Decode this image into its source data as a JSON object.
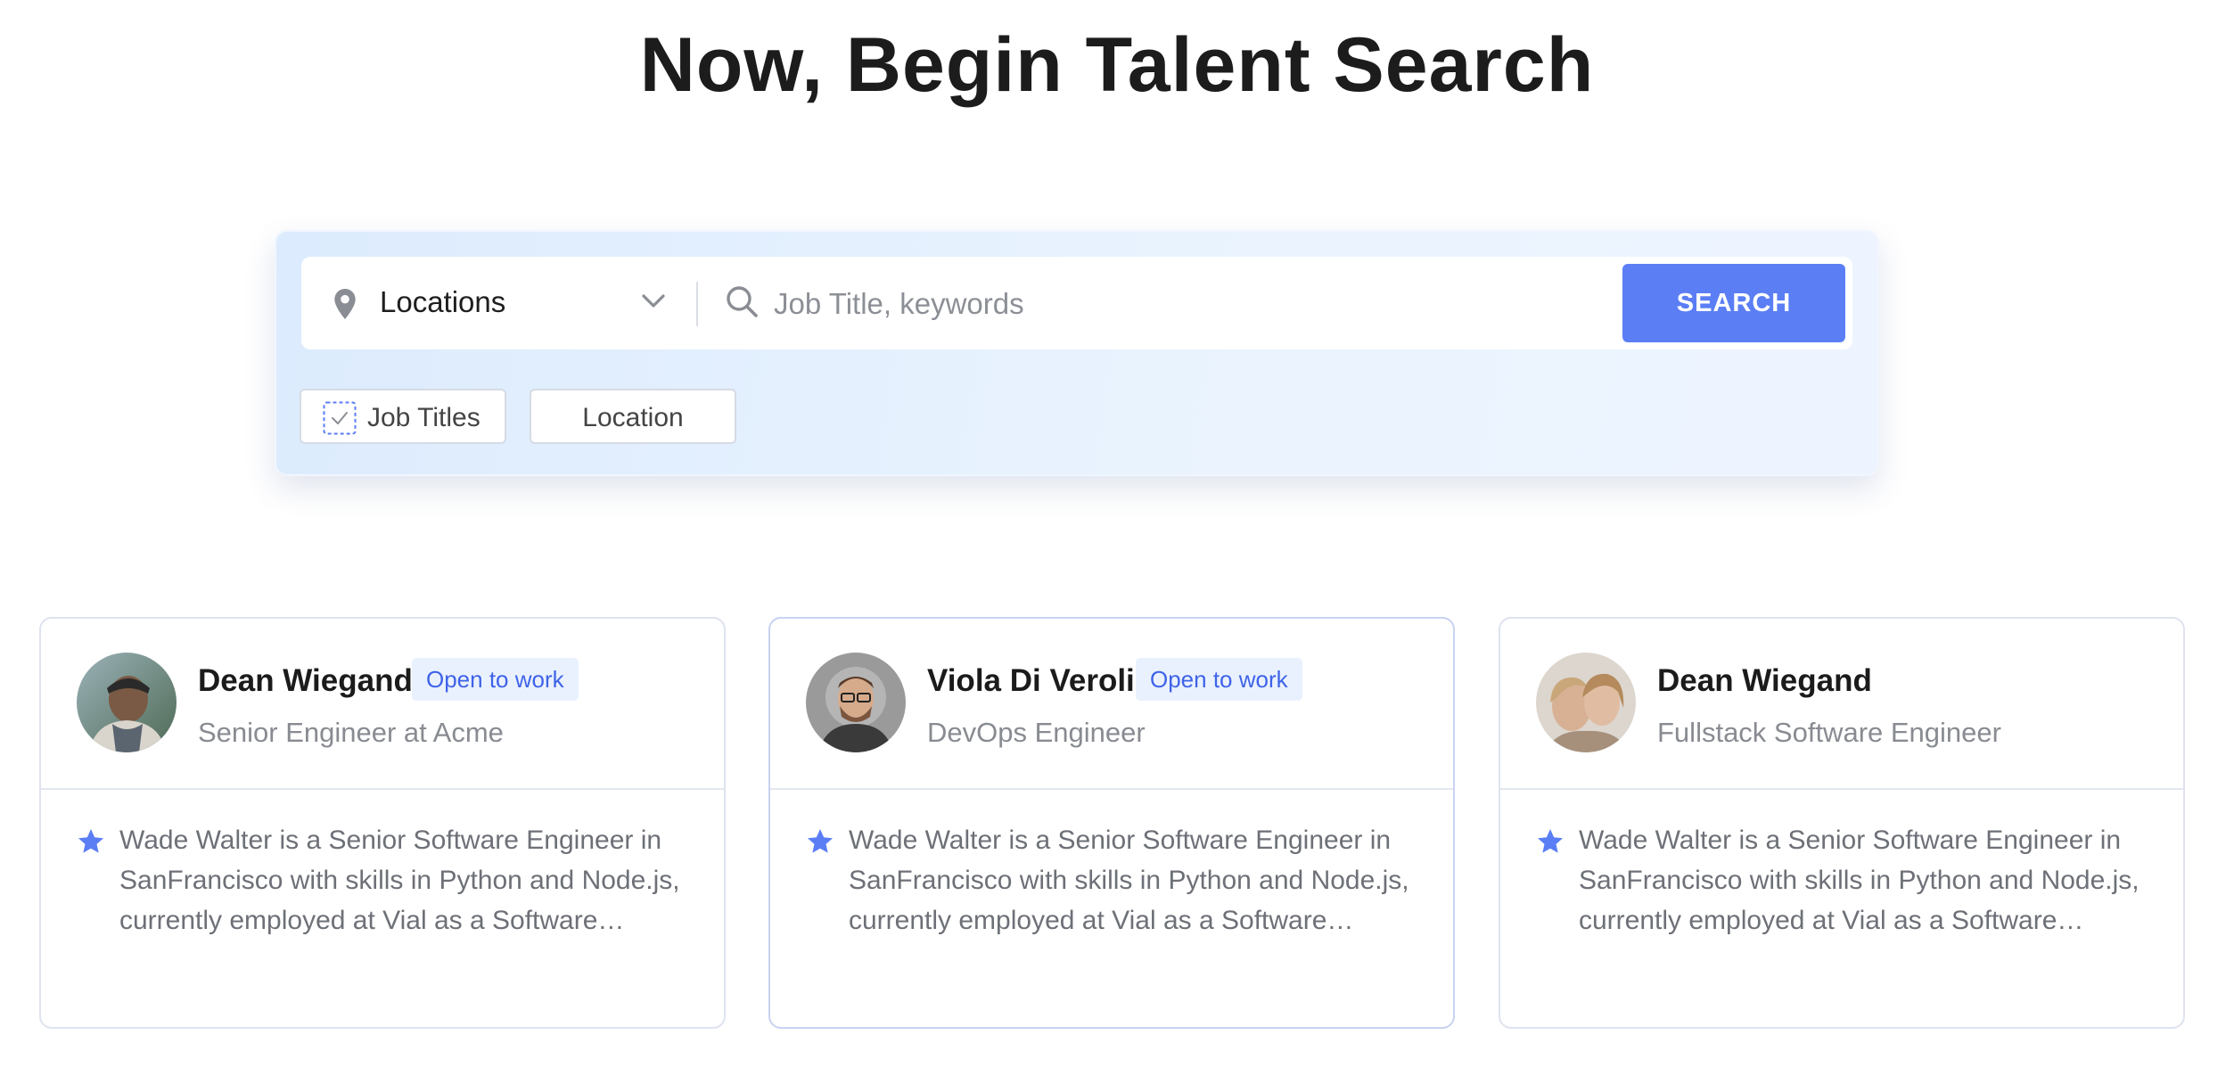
{
  "page": {
    "title": "Now, Begin Talent Search"
  },
  "search": {
    "location_label": "Locations",
    "keywords_placeholder": "Job Title, keywords",
    "button_label": "SEARCH",
    "filters": [
      {
        "label": "Job Titles",
        "checked": true
      },
      {
        "label": "Location",
        "checked": false
      }
    ]
  },
  "candidates": [
    {
      "name": "Dean Wiegand",
      "badge": "Open to work",
      "role": "Senior Engineer at Acme",
      "summary": "Wade Walter is a Senior Software Engineer in SanFrancisco with skills in Python and Node.js, currently employed at Vial as a Software…"
    },
    {
      "name": "Viola Di Veroli",
      "badge": "Open to work",
      "role": "DevOps Engineer",
      "summary": "Wade Walter is a Senior Software Engineer in SanFrancisco with skills in Python and Node.js, currently employed at Vial as a Software…"
    },
    {
      "name": "Dean Wiegand",
      "role": "Fullstack Software Engineer",
      "summary": "Wade Walter is a Senior Software Engineer in SanFrancisco with skills in Python and Node.js, currently employed at Vial as a Software…"
    }
  ],
  "colors": {
    "accent": "#5b7ef5",
    "badge_text": "#3e63e8",
    "badge_bg": "#eaf1fe"
  },
  "icons": [
    "location-pin-icon",
    "chevron-down-icon",
    "search-icon",
    "checkbox-icon",
    "star-icon"
  ]
}
